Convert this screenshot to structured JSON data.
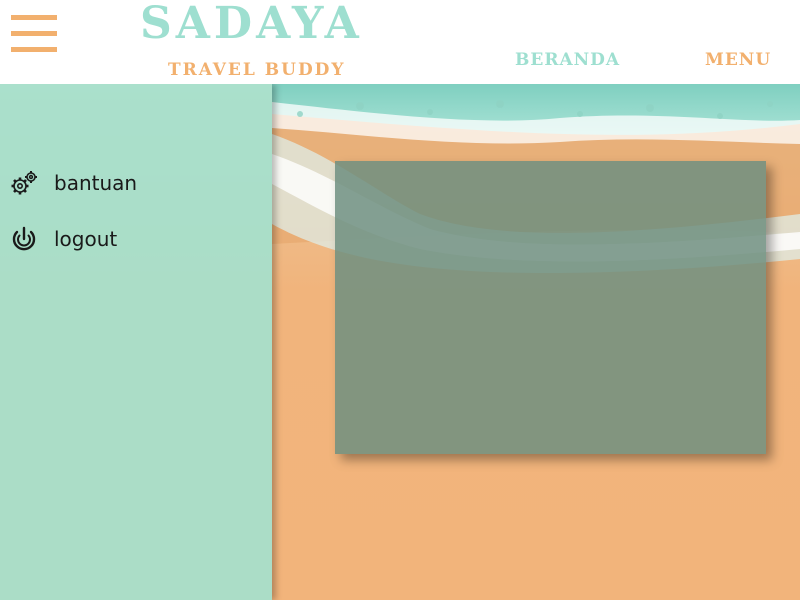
{
  "header": {
    "title": "SADAYA",
    "subtitle": "TRAVEL BUDDY",
    "nav": {
      "beranda": "BERANDA",
      "menu": "MENU"
    }
  },
  "sidebar": {
    "items": [
      {
        "label": "bantuan",
        "icon": "gears-icon"
      },
      {
        "label": "logout",
        "icon": "power-icon"
      }
    ]
  },
  "colors": {
    "mint": "#9edfd0",
    "orange": "#f2b06e",
    "sand": "#f2b47c",
    "panel": "#6f8f80"
  }
}
